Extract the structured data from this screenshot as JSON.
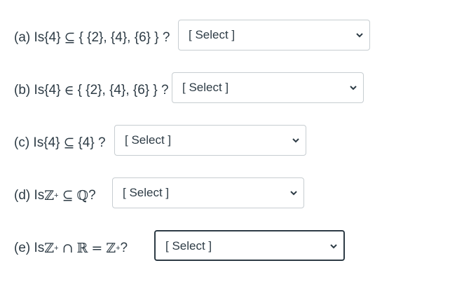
{
  "questions": [
    {
      "label_prefix": "(a) Is ",
      "lhs": "{4}",
      "relation": "⊆",
      "rhs": "{ {2}, {4}, {6} } ?",
      "select": {
        "value": "[ Select ]",
        "focused": false
      }
    },
    {
      "label_prefix": "(b) Is ",
      "lhs": "{4}",
      "relation": "∈",
      "rhs": "{ {2}, {4}, {6} } ?",
      "select": {
        "value": "[ Select ]",
        "focused": false
      }
    },
    {
      "label_prefix": "(c) Is ",
      "lhs": "{4}",
      "relation": "⊆",
      "rhs": "{4} ?",
      "select": {
        "value": "[ Select ]",
        "focused": false
      }
    },
    {
      "label_prefix": "(d) Is ",
      "lhs_symbol": "ℤ",
      "lhs_sup": "+",
      "relation": "⊆",
      "rhs_symbol": "ℚ",
      "suffix": "?",
      "select": {
        "value": "[ Select ]",
        "focused": false
      }
    },
    {
      "label_prefix": "(e) Is ",
      "lhs_symbol": "ℤ",
      "lhs_sup": "+",
      "op": "∩",
      "mid_symbol": "ℝ",
      "eq": "=",
      "rhs_symbol": "ℤ",
      "rhs_sup": "+",
      "suffix": "?",
      "select": {
        "value": "[ Select ]",
        "focused": true
      }
    }
  ],
  "icons": {
    "dropdown": "chevron-down-icon"
  }
}
